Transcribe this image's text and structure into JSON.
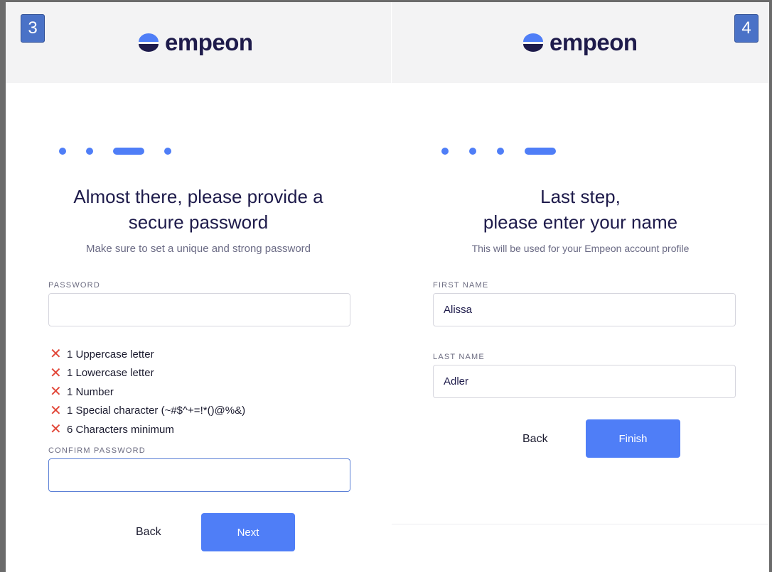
{
  "left_panel": {
    "step_number": "3",
    "logo_text": "empeon",
    "title_line1": "Almost there, please provide a",
    "title_line2": "secure password",
    "subtitle": "Make sure to set a unique and strong password",
    "password_label": "PASSWORD",
    "password_value": "",
    "rules": [
      {
        "text": "1 Uppercase letter",
        "icon": "x-icon"
      },
      {
        "text": "1 Lowercase letter",
        "icon": "x-icon"
      },
      {
        "text": "1 Number",
        "icon": "x-icon"
      },
      {
        "text": "1 Special character (~#$^+=!*()@%&)",
        "icon": "x-icon"
      },
      {
        "text": "6 Characters minimum",
        "icon": "x-icon"
      }
    ],
    "confirm_label": "CONFIRM PASSWORD",
    "confirm_value": "",
    "back_label": "Back",
    "next_label": "Next",
    "progress": {
      "total": 4,
      "current": 3
    }
  },
  "right_panel": {
    "step_number": "4",
    "logo_text": "empeon",
    "title_line1": "Last step,",
    "title_line2": "please enter your name",
    "subtitle": "This will be used for your Empeon account profile",
    "first_name_label": "FIRST NAME",
    "first_name_value": "Alissa",
    "last_name_label": "LAST NAME",
    "last_name_value": "Adler",
    "back_label": "Back",
    "finish_label": "Finish",
    "progress": {
      "total": 4,
      "current": 4
    }
  },
  "colors": {
    "accent": "#4f7ef7",
    "brand_dark": "#1e1b4b",
    "error": "#e2483a",
    "badge": "#4a72c7"
  }
}
